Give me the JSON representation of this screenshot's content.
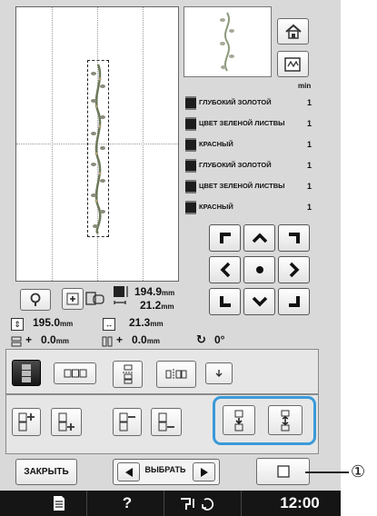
{
  "threads": [
    {
      "name": "ГЛУБОКИЙ ЗОЛОТОЙ",
      "num": "1"
    },
    {
      "name": "ЦВЕТ ЗЕЛЕНОЙ ЛИСТВЫ",
      "num": "1"
    },
    {
      "name": "КРАСНЫЙ",
      "num": "1"
    },
    {
      "name": "ГЛУБОКИЙ ЗОЛОТОЙ",
      "num": "1"
    },
    {
      "name": "ЦВЕТ ЗЕЛЕНОЙ ЛИСТВЫ",
      "num": "1"
    },
    {
      "name": "КРАСНЫЙ",
      "num": "1"
    }
  ],
  "thread_list_unit": "min",
  "size": {
    "height": "194.9",
    "width": "21.2",
    "unit": "mm"
  },
  "distance": {
    "total_length": "195.0",
    "spacing": "21.3",
    "unit": "mm"
  },
  "offset": {
    "x": "0.0",
    "y": "0.0",
    "unit": "mm",
    "plus_x": "+",
    "plus_y": "+",
    "angle": "0°"
  },
  "controls": {
    "close_label": "ЗАКРЫТЬ",
    "select_label": "ВЫБРАТЬ"
  },
  "status": {
    "time": "12:00",
    "help": "?"
  },
  "callout": {
    "number": "①"
  },
  "colors": {
    "panel_bg": "#d9d9d9",
    "highlight_border": "#3a9ad9",
    "bottom_bar": "#151515"
  }
}
